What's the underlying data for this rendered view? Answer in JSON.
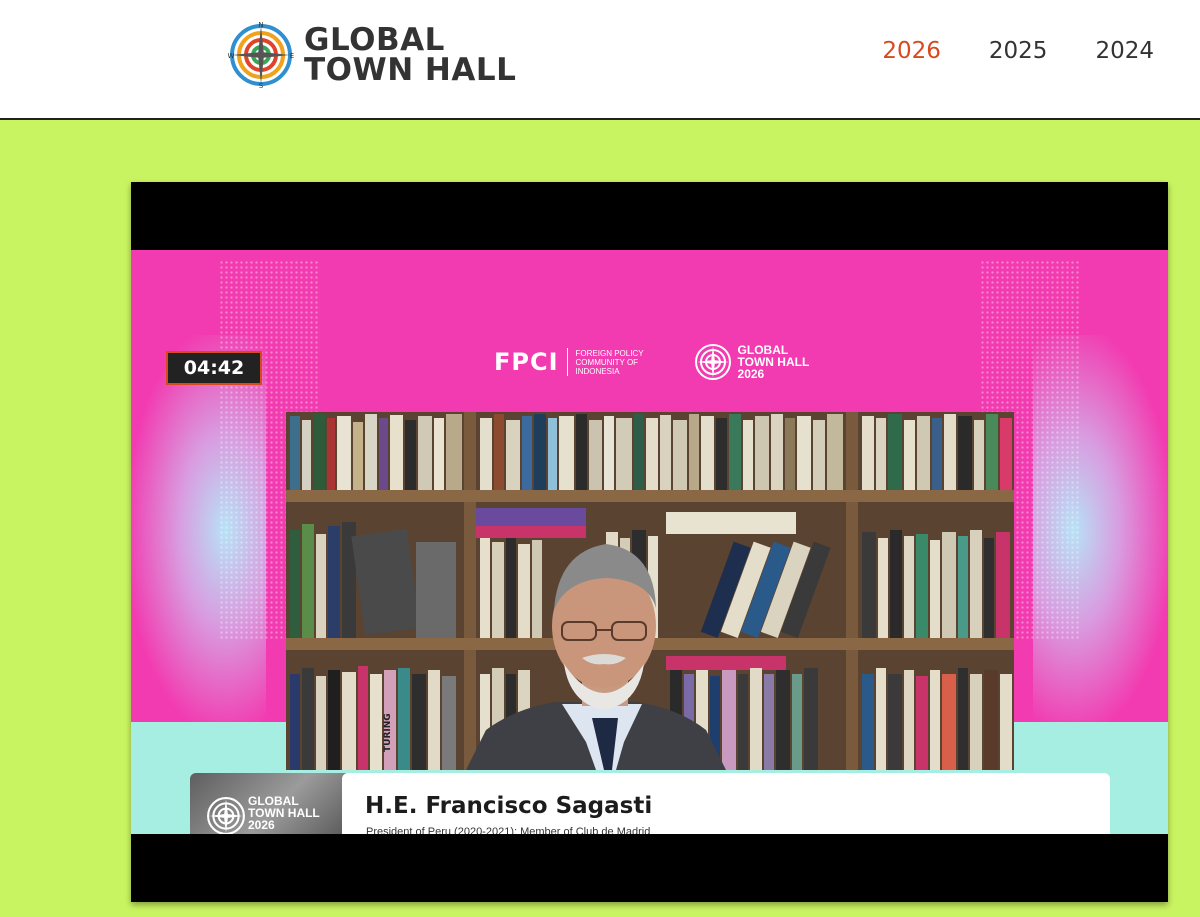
{
  "header": {
    "logo_line1": "GLOBAL",
    "logo_line2": "TOWN HALL",
    "logo_compass": [
      "N",
      "E",
      "S",
      "W"
    ],
    "nav": [
      {
        "label": "2026",
        "active": true
      },
      {
        "label": "2025",
        "active": false
      },
      {
        "label": "2024",
        "active": false
      }
    ]
  },
  "video": {
    "timer": "04:42",
    "fpci_logo": "FPCI",
    "fpci_sub": "FOREIGN POLICY COMMUNITY OF INDONESIA",
    "gth_badge_line1": "GLOBAL",
    "gth_badge_line2": "TOWN HALL",
    "gth_badge_line3": "2026",
    "book_titles": [
      "TURING"
    ],
    "lower_third": {
      "brand_line1": "GLOBAL",
      "brand_line2": "TOWN HALL",
      "brand_line3": "2026",
      "name": "H.E. Francisco Sagasti",
      "role": "President of Peru (2020-2021); Member of Club de Madrid"
    }
  },
  "colors": {
    "page_bg": "#c9f461",
    "accent": "#d8491e",
    "stage_pink": "#f23bb0",
    "stage_cyan": "#a7eee2"
  }
}
